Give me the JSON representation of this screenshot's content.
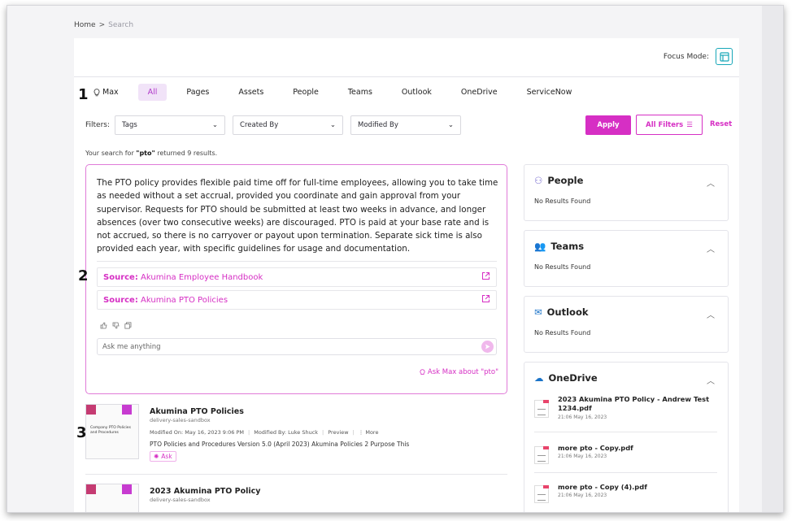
{
  "breadcrumb": {
    "home": "Home",
    "separator": ">",
    "current": "Search"
  },
  "focus_mode": {
    "label": "Focus Mode:"
  },
  "tabs": [
    {
      "label": "Max",
      "icon": "lightbulb-icon"
    },
    {
      "label": "All",
      "active": true
    },
    {
      "label": "Pages"
    },
    {
      "label": "Assets"
    },
    {
      "label": "People"
    },
    {
      "label": "Teams"
    },
    {
      "label": "Outlook"
    },
    {
      "label": "OneDrive"
    },
    {
      "label": "ServiceNow"
    }
  ],
  "filters": {
    "label": "Filters:",
    "dropdowns": [
      {
        "selected": "Tags"
      },
      {
        "selected": "Created By"
      },
      {
        "selected": "Modified By"
      }
    ],
    "apply_label": "Apply",
    "all_filters_label": "All Filters",
    "reset_label": "Reset"
  },
  "search": {
    "prefix": "Your search for ",
    "query": "\"pto\"",
    "suffix": " returned 9 results."
  },
  "ai_answer": {
    "text": "The PTO policy provides flexible paid time off for full-time employees, allowing you to take time as needed without a set accrual, provided you coordinate and gain approval from your supervisor. Requests for PTO should be submitted at least two weeks in advance, and longer absences (over two consecutive weeks) are discouraged. PTO is paid at your base rate and is not accrued, so there is no carryover or payout upon termination. Separate sick time is also provided each year, with specific guidelines for usage and documentation.",
    "sources": [
      {
        "prefix": "Source:",
        "title": "Akumina Employee Handbook"
      },
      {
        "prefix": "Source:",
        "title": "Akumina PTO Policies"
      }
    ],
    "ask_placeholder": "Ask me anything",
    "ask_max_label": "Ask Max about \"pto\""
  },
  "results": [
    {
      "title": "Akumina PTO Policies",
      "site": "delivery-sales-sandbox",
      "modified_on": "Modified On: May 16, 2023 9:06 PM",
      "modified_by": "Modified By: Luke Shuck",
      "preview_label": "Preview",
      "more_label": "More",
      "description": "PTO Policies and Procedures Version 5.0 (April 2023) Akumina Policies 2 Purpose This",
      "ask_label": "Ask",
      "thumb_text": "Company PTO Policies and Procedures"
    },
    {
      "title": "2023 Akumina PTO Policy",
      "site": "delivery-sales-sandbox"
    }
  ],
  "sidebar": [
    {
      "title": "People",
      "icon": "people-icon",
      "empty_text": "No Results Found"
    },
    {
      "title": "Teams",
      "icon": "teams-icon",
      "empty_text": "No Results Found"
    },
    {
      "title": "Outlook",
      "icon": "outlook-icon",
      "empty_text": "No Results Found"
    },
    {
      "title": "OneDrive",
      "icon": "onedrive-icon"
    }
  ],
  "onedrive_items": [
    {
      "name": "2023 Akumina PTO Policy - Andrew Test 1234.pdf",
      "date": "21:06 May 16, 2023"
    },
    {
      "name": "more pto - Copy.pdf",
      "date": "21:06 May 16, 2023"
    },
    {
      "name": "more pto - Copy (4).pdf",
      "date": "21:06 May 16, 2023"
    }
  ],
  "annotations": [
    "1",
    "2",
    "3"
  ],
  "colors": {
    "accent": "#d62fc4",
    "focus": "#17a7b8",
    "active_tab_bg": "#f1e3f8"
  }
}
